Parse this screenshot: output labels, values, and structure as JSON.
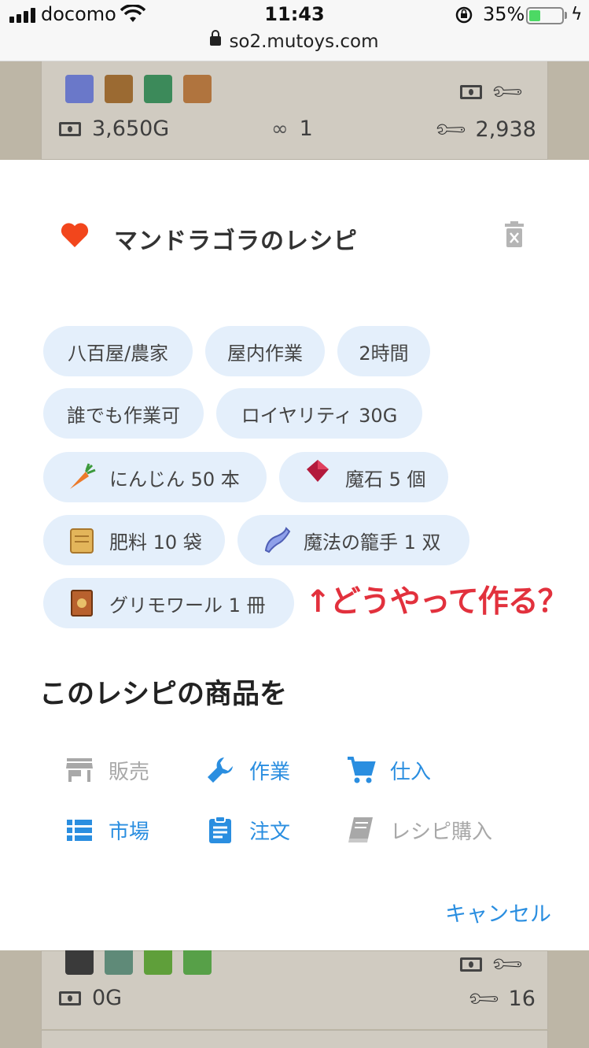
{
  "status_bar": {
    "carrier": "docomo",
    "time": "11:43",
    "battery_percent": "35%",
    "battery_level": 0.35,
    "url": "so2.mutoys.com"
  },
  "background": {
    "top_card": {
      "price": "3,650G",
      "links": "1",
      "work": "2,938"
    },
    "bottom_card": {
      "price": "0G",
      "work": "16"
    }
  },
  "modal": {
    "title": "マンドラゴラのレシピ",
    "tags": [
      "八百屋/農家",
      "屋内作業",
      "2時間",
      "誰でも作業可",
      "ロイヤリティ 30G"
    ],
    "ingredients": [
      {
        "label": "にんじん 50 本",
        "icon": "carrot-icon"
      },
      {
        "label": "魔石 5 個",
        "icon": "magic-stone-icon"
      },
      {
        "label": "肥料 10 袋",
        "icon": "fertilizer-bag-icon"
      },
      {
        "label": "魔法の籠手 1 双",
        "icon": "magic-gauntlet-icon"
      },
      {
        "label": "グリモワール 1 冊",
        "icon": "grimoire-icon"
      }
    ],
    "annotation": "↑どうやって作る？",
    "section_title": "このレシピの商品を",
    "actions": [
      {
        "label": "販売",
        "icon": "store-icon",
        "enabled": false
      },
      {
        "label": "作業",
        "icon": "wrench-icon",
        "enabled": true
      },
      {
        "label": "仕入",
        "icon": "cart-icon",
        "enabled": true
      },
      {
        "label": "市場",
        "icon": "list-icon",
        "enabled": true
      },
      {
        "label": "注文",
        "icon": "clipboard-icon",
        "enabled": true
      },
      {
        "label": "レシピ購入",
        "icon": "book-icon",
        "enabled": false
      }
    ],
    "cancel_label": "キャンセル"
  },
  "colors": {
    "accent": "#2a8ee0",
    "chip_bg": "#e4effb",
    "heart": "#f2461c",
    "annotation": "#e2313d",
    "disabled": "#a8a8a8"
  }
}
